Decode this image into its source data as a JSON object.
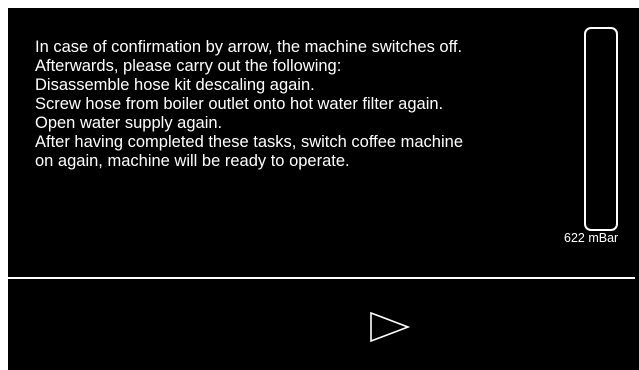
{
  "message": {
    "lines": [
      "In case of confirmation by arrow, the machine switches off.",
      "Afterwards, please carry out the following:",
      "Disassemble hose kit descaling again.",
      "Screw hose from boiler outlet onto hot water filter again.",
      "Open water supply again.",
      "After having completed these tasks, switch coffee machine",
      "on again, machine will be ready to operate."
    ]
  },
  "gauge": {
    "readout": "622 mBar",
    "fill_fraction": 0
  },
  "confirm": {
    "icon": "play-arrow-outline-icon"
  },
  "colors": {
    "background": "#000000",
    "foreground": "#ffffff"
  }
}
